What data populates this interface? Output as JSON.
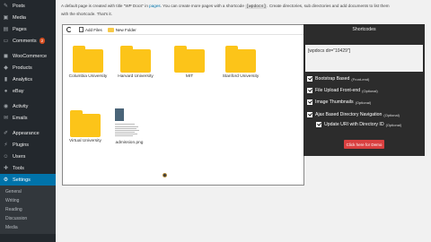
{
  "sidebar": {
    "items": [
      {
        "label": "Posts",
        "icon": "pin-icon"
      },
      {
        "label": "Media",
        "icon": "media-icon"
      },
      {
        "label": "Pages",
        "icon": "pages-icon"
      },
      {
        "label": "Comments",
        "icon": "comments-icon",
        "badge": "2"
      },
      {
        "label": "WooCommerce",
        "icon": "woocommerce-icon"
      },
      {
        "label": "Products",
        "icon": "products-icon"
      },
      {
        "label": "Analytics",
        "icon": "analytics-icon"
      },
      {
        "label": "eBay",
        "icon": "ebay-icon"
      },
      {
        "label": "Activity",
        "icon": "activity-icon"
      },
      {
        "label": "Emails",
        "icon": "emails-icon"
      },
      {
        "label": "Appearance",
        "icon": "appearance-icon"
      },
      {
        "label": "Plugins",
        "icon": "plugins-icon"
      },
      {
        "label": "Users",
        "icon": "users-icon"
      },
      {
        "label": "Tools",
        "icon": "tools-icon"
      },
      {
        "label": "Settings",
        "icon": "settings-icon"
      }
    ],
    "submenu": [
      "General",
      "Writing",
      "Reading",
      "Discussion",
      "Media"
    ]
  },
  "intro": {
    "line1a": "A default page is created with title \"WP Docs\" in ",
    "line1link": "pages",
    "line1b": ". You can create more pages with a shortcode ",
    "line1code": "[wpdocs]",
    "line1c": ". Create directories, sub directories and add documents to list them",
    "line2": "with the shortcode. That's it."
  },
  "toolbar": {
    "add_files": "Add Files",
    "new_folder": "New Folder"
  },
  "folders": [
    {
      "label": "Columbia University"
    },
    {
      "label": "Harvard University"
    },
    {
      "label": "MIT"
    },
    {
      "label": "Stanford University"
    },
    {
      "label": "Virtual University"
    }
  ],
  "file": {
    "label": "admission.png"
  },
  "shortcodes": {
    "title": "Shortcodes",
    "code": "[wpdocs dir=\"10429\"]",
    "options": [
      {
        "label": "Bootstrap Based",
        "note": "(Front-end)"
      },
      {
        "label": "File Upload Front-end",
        "note": "(Optional)"
      },
      {
        "label": "Image Thumbnails",
        "note": "(Optional)"
      },
      {
        "label": "Ajax Based Directory Navigation",
        "note": "(Optional)"
      },
      {
        "label": "Update URI with Directory ID",
        "note": "(Optional)"
      }
    ],
    "button": "Click here for Demo",
    "accent": "#d94040"
  }
}
